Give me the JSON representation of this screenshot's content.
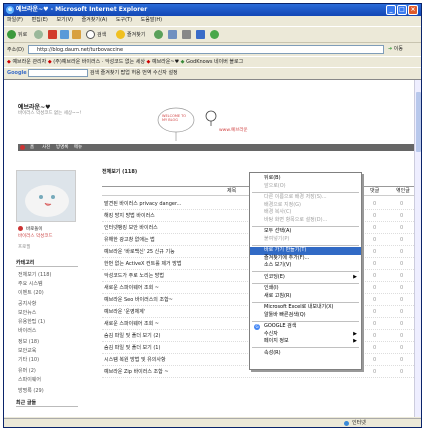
{
  "window": {
    "title": "예브라운~♥ - Microsoft Internet Explorer"
  },
  "menubar": [
    "파일(F)",
    "편집(E)",
    "보기(V)",
    "즐겨찾기(A)",
    "도구(T)",
    "도움말(H)"
  ],
  "toolbar": {
    "back": "뒤로",
    "search": "검색",
    "favorites": "즐겨찾기"
  },
  "address": {
    "label": "주소(D)",
    "url": "http://blog.daum.net/turbovaccine",
    "go": "이동"
  },
  "links": [
    "예브라운 관리자",
    "(주)예브라운 바이러스 · 악성코드 없는 세상",
    "예브라운~♥",
    "GodKnows 네이버 블로그"
  ],
  "googlebar": {
    "label": "Google",
    "items": [
      "검색",
      "즐겨찾기",
      "팝업 허용",
      "번역",
      "수신자",
      "설정"
    ]
  },
  "blog": {
    "title": "예브라운~♥",
    "subtitle": "바이러스 악성코드 없는 세상~~!",
    "nav": [
      "홈",
      "사진",
      "방명록",
      "메뉴"
    ],
    "signature": "www.예브라운",
    "logo_text": "WELCOME TO MY BLOG",
    "profile_lines": [
      "바로돌이",
      "바이러스 악성코드"
    ],
    "profile_link": "프로필",
    "categories_title": "카테고리",
    "categories": [
      "전체보기 (118)",
      "주요 시스템",
      "이벤트 (20)",
      "공지사항",
      "보안뉴스",
      "유용한팁 (1)",
      "바이러스",
      "정보 (18)",
      "보안교육",
      "기타 (10)",
      "유머 (2)",
      "스파이웨어",
      "방명록 (29)"
    ],
    "recent_title": "최근 글들",
    "list_header": "전체보기 (118)",
    "col_title": "제목",
    "col_views": "댓글",
    "col_date": "엮인글",
    "posts": [
      "발견된 바이러스 privacy danger...",
      "해킹 방지 방법 바이러스",
      "인터넷뱅킹 보안 바이러스",
      "유해한 광고창 없애는 법",
      "예브라운 '바로백신' 25 신규 기능",
      "한번 없는 ActiveX 컨트롤 제거 방법",
      "악성코드가 주로 노리는 방법",
      "새로운 스파이웨어 조회 ~",
      "예브라운 Seo 바이러스의 조합~",
      "예브라운 '운영체계'",
      "새로운 스파이웨어 조회 ~",
      "숨김 파일 및 폴더 보기 (2)",
      "숨김 파일 및 폴더 보기 (1)",
      "시스템 복원 방법 및 유의사항",
      "예브라운 Zip 바이러스 조합 ~"
    ]
  },
  "context_menu": {
    "items": [
      {
        "label": "뒤로(B)",
        "state": "normal"
      },
      {
        "label": "앞으로(O)",
        "state": "disabled"
      },
      {
        "sep": true
      },
      {
        "label": "다른 이름으로 배경 저장(S)...",
        "state": "disabled"
      },
      {
        "label": "배경으로 지정(G)",
        "state": "disabled"
      },
      {
        "label": "배경 복사(C)",
        "state": "disabled"
      },
      {
        "label": "바탕 화면 항목으로 설정(D)...",
        "state": "disabled"
      },
      {
        "sep": true
      },
      {
        "label": "모두 선택(A)",
        "state": "normal"
      },
      {
        "label": "붙여넣기(P)",
        "state": "disabled"
      },
      {
        "sep": true
      },
      {
        "label": "바로 가기 만들기(T)",
        "state": "highlighted"
      },
      {
        "label": "즐겨찾기에 추가(F)...",
        "state": "normal"
      },
      {
        "label": "소스 보기(V)",
        "state": "normal"
      },
      {
        "sep": true
      },
      {
        "label": "인코딩(E)",
        "state": "normal",
        "submenu": true
      },
      {
        "sep": true
      },
      {
        "label": "인쇄(I)",
        "state": "normal"
      },
      {
        "label": "새로 고침(R)",
        "state": "normal"
      },
      {
        "sep": true
      },
      {
        "label": "Microsoft Excel로 내보내기(X)",
        "state": "normal"
      },
      {
        "label": "알툴바 빠른검색(Q)",
        "state": "normal"
      },
      {
        "sep": true
      },
      {
        "label": "GOOGLE 검색",
        "state": "normal",
        "google": true
      },
      {
        "label": "수신자",
        "state": "normal",
        "submenu": true
      },
      {
        "label": "페이지 정보",
        "state": "normal",
        "submenu": true
      },
      {
        "sep": true
      },
      {
        "label": "속성(R)",
        "state": "normal"
      }
    ]
  },
  "status": {
    "text": "",
    "zone": "인터넷"
  },
  "colors": {
    "titlebar": "#1f5fcf",
    "highlight": "#316ac5",
    "chrome": "#ece9d8"
  }
}
